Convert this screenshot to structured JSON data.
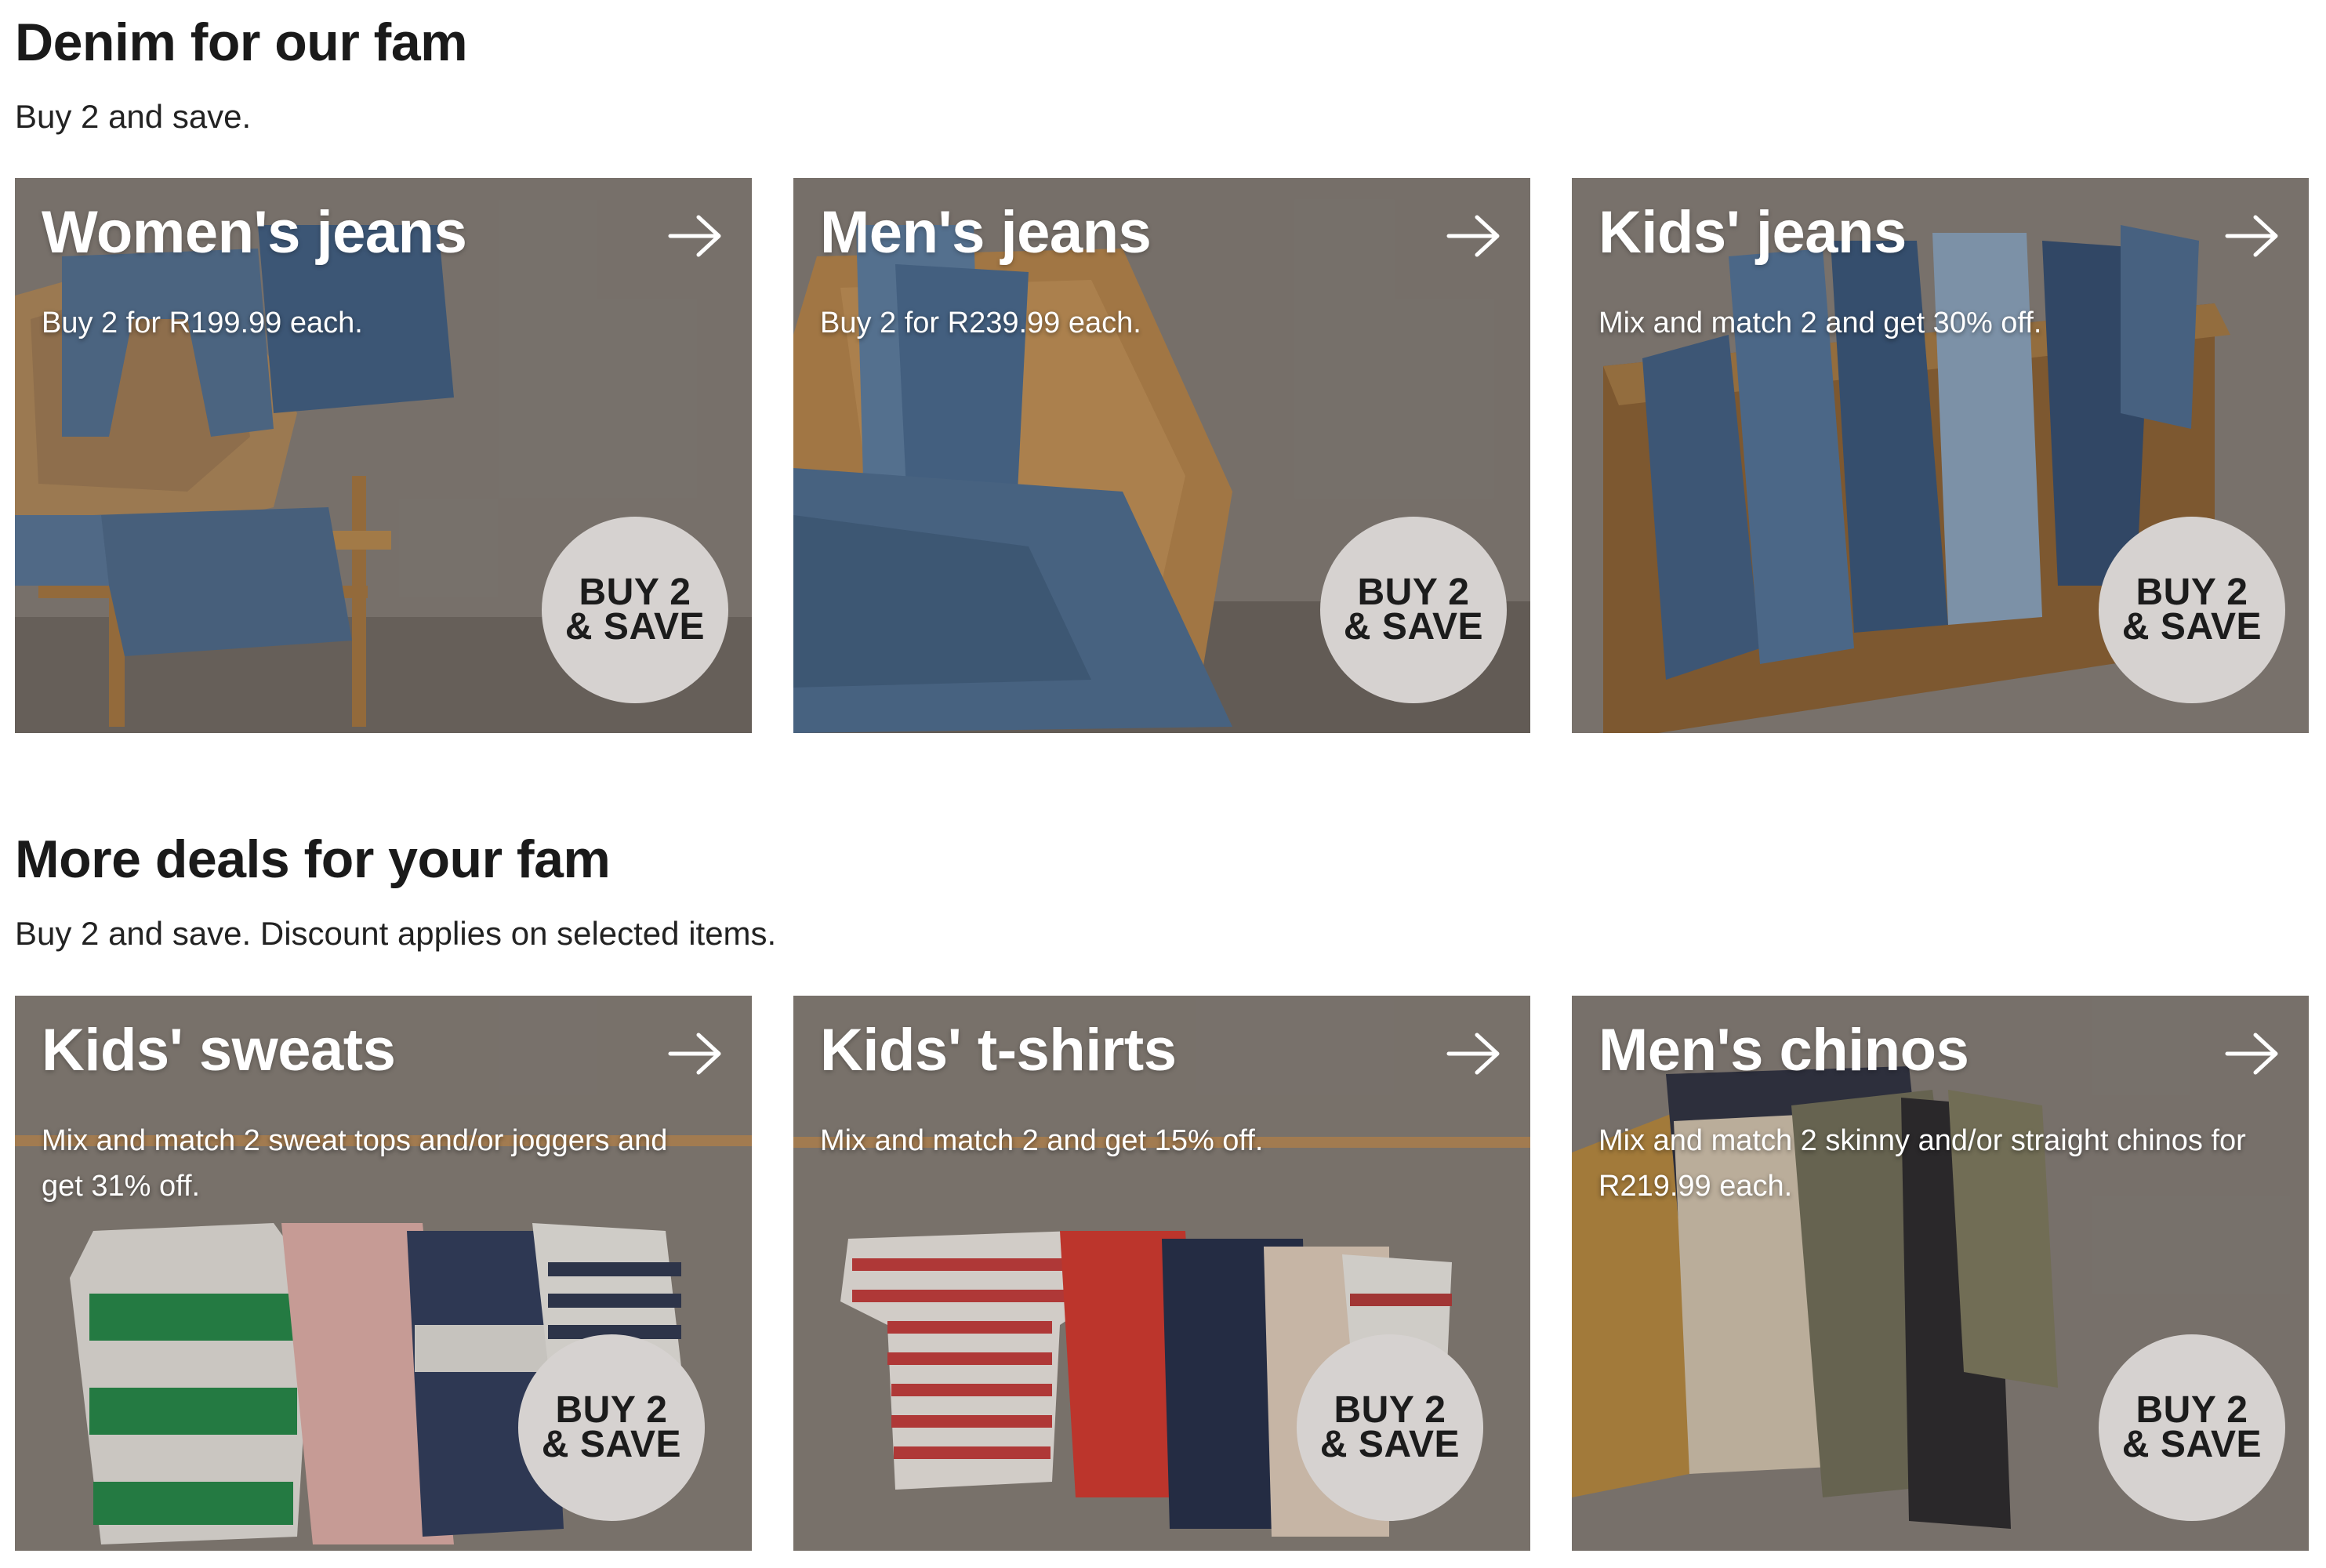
{
  "sections": [
    {
      "title": "Denim for our fam",
      "subtitle": "Buy 2 and save.",
      "cards": [
        {
          "title": "Women's jeans",
          "description": "Buy 2 for R199.99 each.",
          "badge_line1": "BUY 2",
          "badge_line2": "& SAVE",
          "arrow_icon": "arrow-right-icon"
        },
        {
          "title": "Men's jeans",
          "description": "Buy 2 for R239.99 each.",
          "badge_line1": "BUY 2",
          "badge_line2": "& SAVE",
          "arrow_icon": "arrow-right-icon"
        },
        {
          "title": "Kids' jeans",
          "description": "Mix and match 2 and get 30% off.",
          "badge_line1": "BUY 2",
          "badge_line2": "& SAVE",
          "arrow_icon": "arrow-right-icon"
        }
      ]
    },
    {
      "title": "More deals for your fam",
      "subtitle": "Buy 2 and save. Discount applies on selected items.",
      "cards": [
        {
          "title": "Kids' sweats",
          "description": "Mix and match 2 sweat tops and/or joggers and get 31% off.",
          "badge_line1": "BUY 2",
          "badge_line2": "& SAVE",
          "arrow_icon": "arrow-right-icon"
        },
        {
          "title": "Kids' t-shirts",
          "description": "Mix and match 2 and get 15% off.",
          "badge_line1": "BUY 2",
          "badge_line2": "& SAVE",
          "arrow_icon": "arrow-right-icon"
        },
        {
          "title": "Men's chinos",
          "description": "Mix and match 2 skinny and/or straight chinos for R219.99 each.",
          "badge_line1": "BUY 2",
          "badge_line2": "& SAVE",
          "arrow_icon": "arrow-right-icon"
        }
      ]
    }
  ],
  "colors": {
    "card_background": "#7b7570",
    "badge_background": "#d6d2d0",
    "text_on_card": "#ffffff",
    "heading": "#1a1a1a"
  }
}
